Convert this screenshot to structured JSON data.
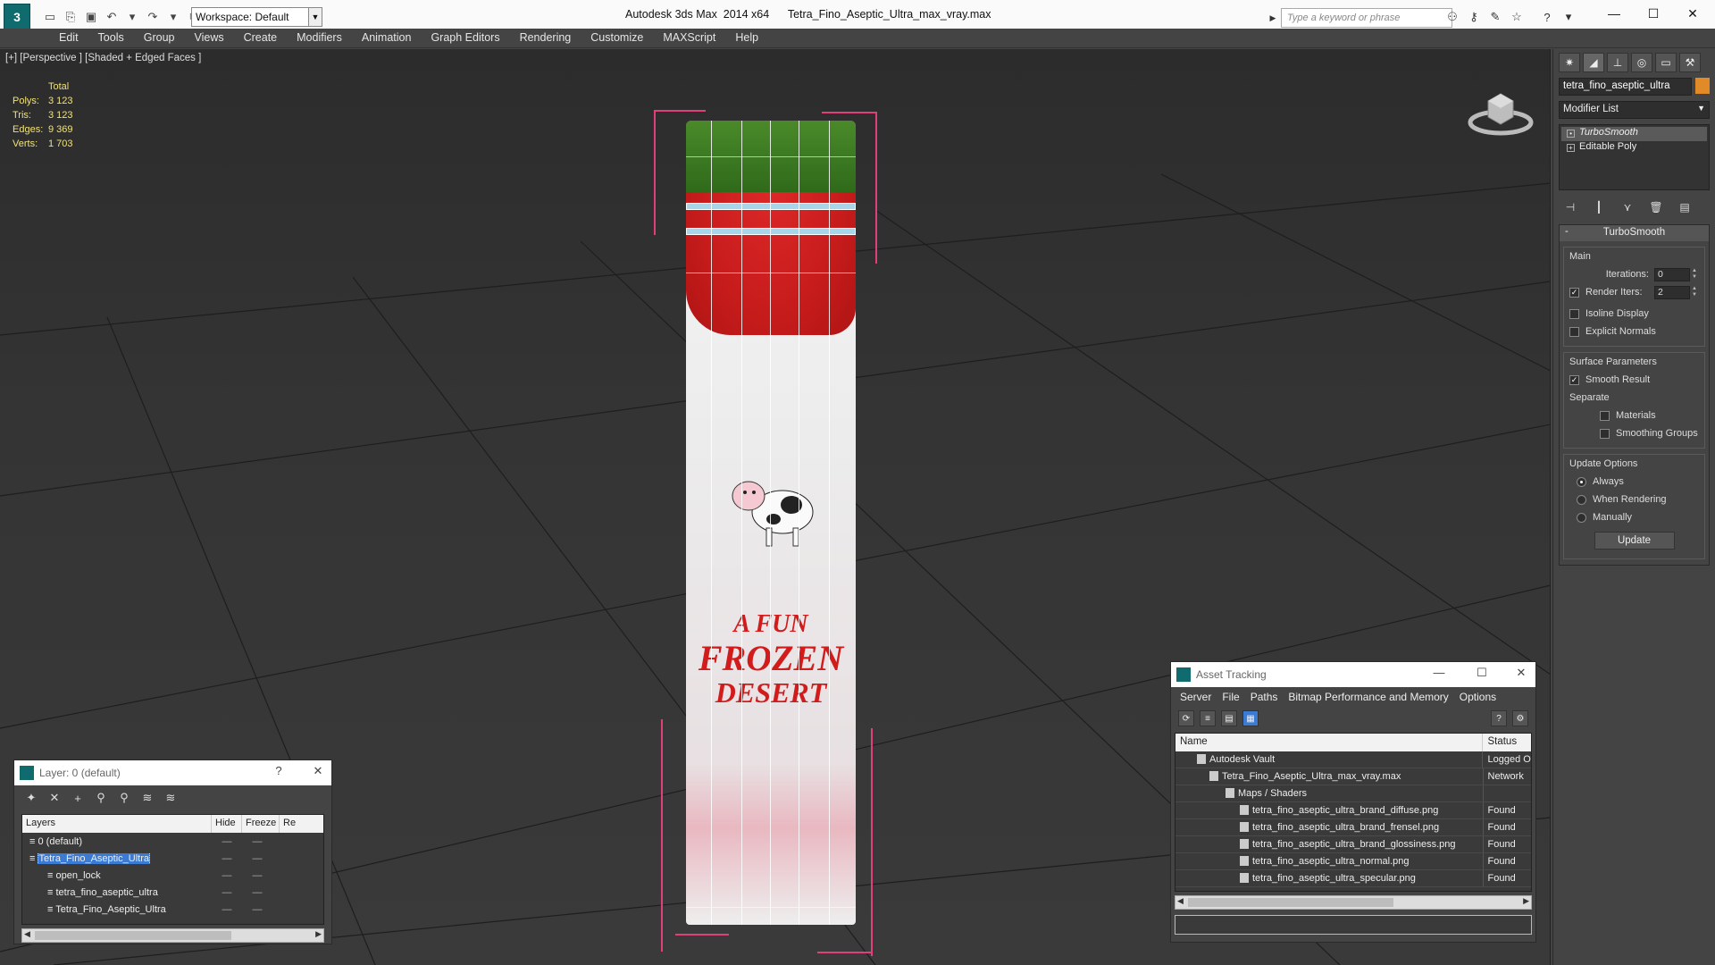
{
  "titlebar": {
    "app_logo": "3",
    "workspace": "Workspace: Default",
    "app_title": "Autodesk 3ds Max  2014 x64",
    "file_name": "Tetra_Fino_Aseptic_Ultra_max_vray.max",
    "search_placeholder": "Type a keyword or phrase"
  },
  "menu": [
    "Edit",
    "Tools",
    "Group",
    "Views",
    "Create",
    "Modifiers",
    "Animation",
    "Graph Editors",
    "Rendering",
    "Customize",
    "MAXScript",
    "Help"
  ],
  "viewport": {
    "label": "[+] [Perspective ] [Shaded + Edged Faces ]",
    "stats_header": "Total",
    "stats": [
      {
        "key": "Polys:",
        "value": "3 123"
      },
      {
        "key": "Tris:",
        "value": "3 123"
      },
      {
        "key": "Edges:",
        "value": "9 369"
      },
      {
        "key": "Verts:",
        "value": "1 703"
      }
    ],
    "package_text": {
      "line1": "A FUN",
      "line2": "FROZEN",
      "line3": "DESERT"
    }
  },
  "command_panel": {
    "object_name": "tetra_fino_aseptic_ultra",
    "object_color": "#e08a28",
    "modifier_list": "Modifier List",
    "stack": [
      {
        "label": "TurboSmooth",
        "selected": true
      },
      {
        "label": "Editable Poly",
        "selected": false
      }
    ],
    "rollout_title": "TurboSmooth",
    "main_group": "Main",
    "iterations_label": "Iterations:",
    "iterations_value": "0",
    "render_iters_label": "Render Iters:",
    "render_iters_value": "2",
    "isoline_display": "Isoline Display",
    "explicit_normals": "Explicit Normals",
    "surface_group": "Surface Parameters",
    "smooth_result": "Smooth Result",
    "separate": "Separate",
    "materials": "Materials",
    "smoothing_groups": "Smoothing Groups",
    "update_group": "Update Options",
    "always": "Always",
    "when_rendering": "When Rendering",
    "manually": "Manually",
    "update_button": "Update"
  },
  "asset_tracking": {
    "title": "Asset Tracking",
    "menu": [
      "Server",
      "File",
      "Paths",
      "Bitmap Performance and Memory",
      "Options"
    ],
    "columns": {
      "name": "Name",
      "status": "Status"
    },
    "rows": [
      {
        "name": "Autodesk Vault",
        "status": "Logged O",
        "indent": 24
      },
      {
        "name": "Tetra_Fino_Aseptic_Ultra_max_vray.max",
        "status": "Network",
        "indent": 38
      },
      {
        "name": "Maps / Shaders",
        "status": "",
        "indent": 56
      },
      {
        "name": "tetra_fino_aseptic_ultra_brand_diffuse.png",
        "status": "Found",
        "indent": 72
      },
      {
        "name": "tetra_fino_aseptic_ultra_brand_frensel.png",
        "status": "Found",
        "indent": 72
      },
      {
        "name": "tetra_fino_aseptic_ultra_brand_glossiness.png",
        "status": "Found",
        "indent": 72
      },
      {
        "name": "tetra_fino_aseptic_ultra_normal.png",
        "status": "Found",
        "indent": 72
      },
      {
        "name": "tetra_fino_aseptic_ultra_specular.png",
        "status": "Found",
        "indent": 72
      }
    ]
  },
  "layer_dialog": {
    "title": "Layer: 0 (default)",
    "help": "?",
    "columns": {
      "layers": "Layers",
      "hide": "Hide",
      "freeze": "Freeze",
      "render": "Re"
    },
    "rows": [
      {
        "name": "0 (default)",
        "indent": 0,
        "selected": false
      },
      {
        "name": "Tetra_Fino_Aseptic_Ultra",
        "indent": 0,
        "selected": true
      },
      {
        "name": "open_lock",
        "indent": 20,
        "selected": false
      },
      {
        "name": "tetra_fino_aseptic_ultra",
        "indent": 20,
        "selected": false
      },
      {
        "name": "Tetra_Fino_Aseptic_Ultra",
        "indent": 20,
        "selected": false
      }
    ]
  }
}
